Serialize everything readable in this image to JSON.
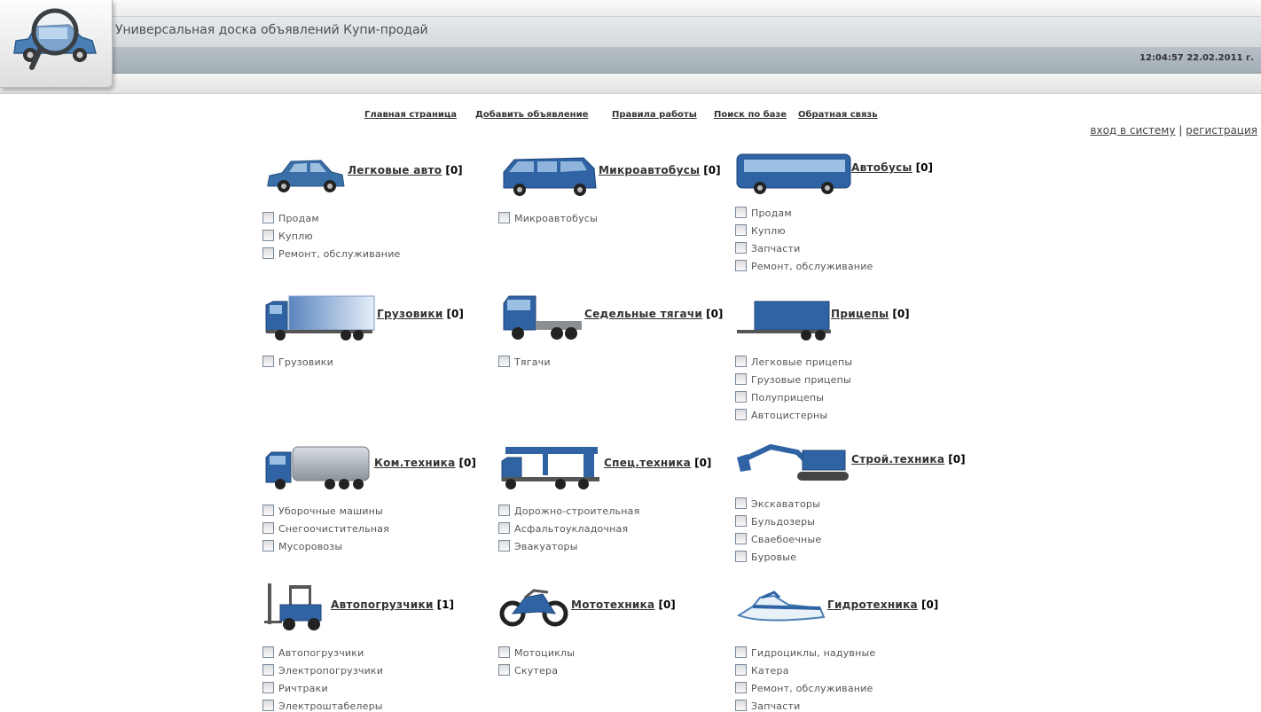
{
  "header": {
    "title": "Универсальная доска объявлений Купи-продай",
    "datetime": "12:04:57 22.02.2011 г."
  },
  "nav": [
    {
      "label": "Главная страница"
    },
    {
      "label": "Добавить объявление"
    },
    {
      "label": "Правила работы"
    },
    {
      "label": "Поиск по базе"
    },
    {
      "label": "Обратная связь"
    }
  ],
  "auth": {
    "login": "вход в систему",
    "separator": "|",
    "register": "регистрация"
  },
  "categories": [
    {
      "name": "Легковые авто",
      "count": "[0]",
      "icon": "car-icon",
      "subs": [
        "Продам",
        "Куплю",
        "Ремонт, обслуживание"
      ]
    },
    {
      "name": "Микроавтобусы",
      "count": "[0]",
      "icon": "minibus-icon",
      "subs": [
        "Микроавтобусы"
      ]
    },
    {
      "name": "Автобусы",
      "count": "[0]",
      "icon": "bus-icon",
      "subs": [
        "Продам",
        "Куплю",
        "Запчасти",
        "Ремонт, обслуживание"
      ]
    },
    {
      "name": "Грузовики",
      "count": "[0]",
      "icon": "truck-icon",
      "subs": [
        "Грузовики"
      ]
    },
    {
      "name": "Седельные тягачи",
      "count": "[0]",
      "icon": "tractor-unit-icon",
      "subs": [
        "Тягачи"
      ]
    },
    {
      "name": "Прицепы",
      "count": "[0]",
      "icon": "trailer-icon",
      "subs": [
        "Легковые прицепы",
        "Грузовые прицепы",
        "Полуприцепы",
        "Автоцистерны"
      ]
    },
    {
      "name": "Ком.техника",
      "count": "[0]",
      "icon": "garbage-truck-icon",
      "subs": [
        "Уборочные машины",
        "Снегоочистительная",
        "Мусоровозы"
      ]
    },
    {
      "name": "Спец.техника",
      "count": "[0]",
      "icon": "crane-truck-icon",
      "subs": [
        "Дорожно-строительная",
        "Асфальтоукладочная",
        "Эвакуаторы"
      ]
    },
    {
      "name": "Строй.техника",
      "count": "[0]",
      "icon": "excavator-icon",
      "subs": [
        "Экскаваторы",
        "Бульдозеры",
        "Сваебоечные",
        "Буровые"
      ]
    },
    {
      "name": "Автопогрузчики",
      "count": "[1]",
      "icon": "forklift-icon",
      "subs": [
        "Автопогрузчики",
        "Электропогрузчики",
        "Ричтраки",
        "Электроштабелеры"
      ]
    },
    {
      "name": "Мототехника",
      "count": "[0]",
      "icon": "motorcycle-icon",
      "subs": [
        "Мотоциклы",
        "Скутера"
      ]
    },
    {
      "name": "Гидротехника",
      "count": "[0]",
      "icon": "jetski-icon",
      "subs": [
        "Гидроциклы, надувные",
        "Катера",
        "Ремонт, обслуживание",
        "Запчасти"
      ]
    }
  ],
  "colors": {
    "vehicle_blue": "#3a6ea5",
    "header_gray": "#a8b2b8"
  }
}
